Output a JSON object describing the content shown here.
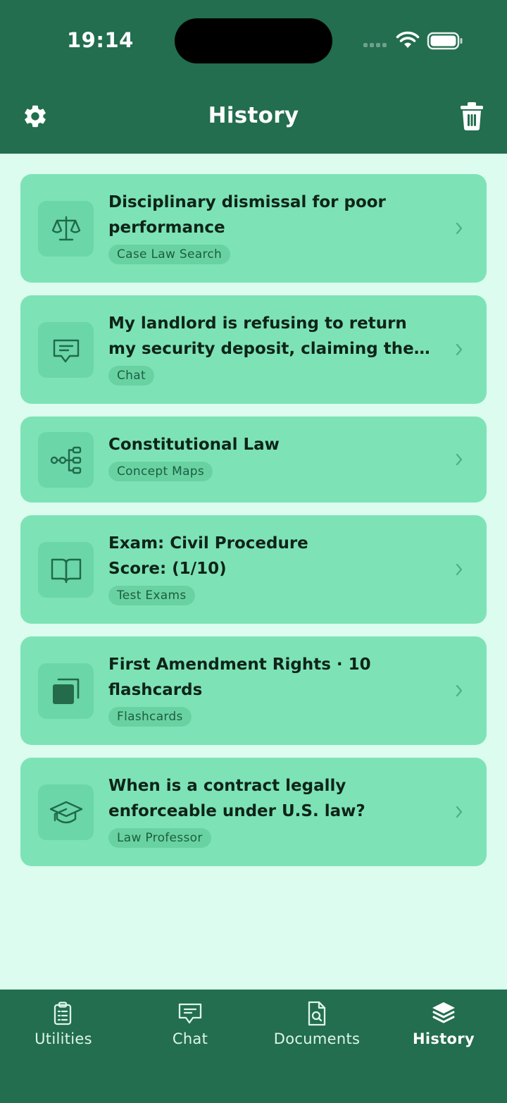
{
  "status": {
    "time": "19:14"
  },
  "header": {
    "title": "History"
  },
  "items": [
    {
      "title": "Disciplinary dismissal for poor performance",
      "tag": "Case Law Search",
      "icon": "scales-icon"
    },
    {
      "title": "My landlord is refusing to return my security deposit, claiming the…",
      "tag": "Chat",
      "icon": "chat-bubble-icon"
    },
    {
      "title": "Constitutional Law",
      "tag": "Concept Maps",
      "icon": "concept-map-icon"
    },
    {
      "title": "Exam: Civil Procedure\nScore: (1/10)",
      "tag": "Test Exams",
      "icon": "book-icon"
    },
    {
      "title": "First Amendment Rights · 10 flashcards",
      "tag": "Flashcards",
      "icon": "flashcards-icon"
    },
    {
      "title": "When is a contract legally enforceable under U.S. law?",
      "tag": "Law Professor",
      "icon": "graduation-cap-icon"
    }
  ],
  "tabs": [
    {
      "label": "Utilities",
      "icon": "clipboard-list-icon"
    },
    {
      "label": "Chat",
      "icon": "chat-bubble-icon"
    },
    {
      "label": "Documents",
      "icon": "document-search-icon"
    },
    {
      "label": "History",
      "icon": "layers-icon",
      "active": true
    }
  ],
  "colors": {
    "header": "#226e4f",
    "background": "#dbfcee",
    "card": "#7de3b6",
    "tag": "#69d2a3"
  }
}
